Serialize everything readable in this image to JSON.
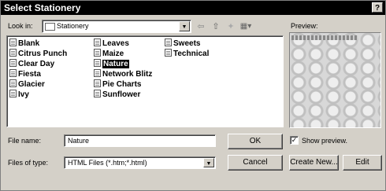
{
  "window": {
    "title": "Select Stationery",
    "help_label": "?"
  },
  "look_in": {
    "label": "Look in:",
    "value": "Stationery"
  },
  "toolbar": {
    "back_icon": "back-icon",
    "up_icon": "up-folder-icon",
    "new_folder_icon": "new-folder-icon",
    "views_icon": "views-menu-icon"
  },
  "files": [
    {
      "name": "Blank"
    },
    {
      "name": "Citrus Punch"
    },
    {
      "name": "Clear Day"
    },
    {
      "name": "Fiesta"
    },
    {
      "name": "Glacier"
    },
    {
      "name": "Ivy"
    },
    {
      "name": "Leaves"
    },
    {
      "name": "Maize"
    },
    {
      "name": "Nature",
      "selected": true
    },
    {
      "name": "Network Blitz"
    },
    {
      "name": "Pie Charts"
    },
    {
      "name": "Sunflower"
    },
    {
      "name": "Sweets"
    },
    {
      "name": "Technical"
    }
  ],
  "file_name": {
    "label": "File name:",
    "value": "Nature"
  },
  "file_type": {
    "label": "Files of type:",
    "value": "HTML Files (*.htm;*.html)"
  },
  "buttons": {
    "ok": "OK",
    "cancel": "Cancel",
    "create_new": "Create New...",
    "edit": "Edit"
  },
  "preview": {
    "label": "Preview:",
    "show_label": "Show preview.",
    "show_checked": true,
    "check_mark": "✓"
  }
}
